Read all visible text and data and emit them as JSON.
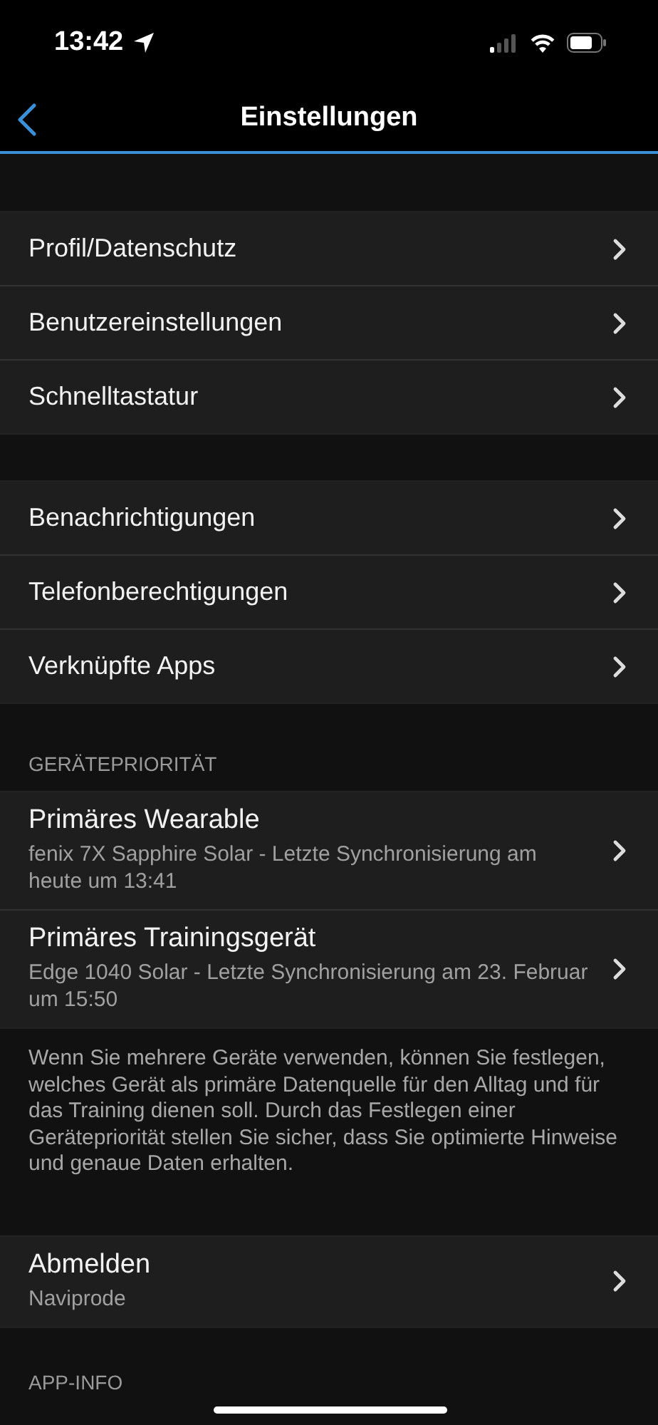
{
  "status_bar": {
    "time": "13:42"
  },
  "nav": {
    "title": "Einstellungen"
  },
  "sections": [
    {
      "items": [
        {
          "title": "Profil/Datenschutz"
        },
        {
          "title": "Benutzereinstellungen"
        },
        {
          "title": "Schnelltastatur"
        }
      ]
    },
    {
      "items": [
        {
          "title": "Benachrichtigungen"
        },
        {
          "title": "Telefonberechtigungen"
        },
        {
          "title": "Verknüpfte Apps"
        }
      ]
    },
    {
      "header": "GERÄTEPRIORITÄT",
      "items": [
        {
          "title": "Primäres Wearable",
          "subtitle": "fenix 7X Sapphire Solar - Letzte Synchronisierung am heute um 13:41"
        },
        {
          "title": "Primäres Trainingsgerät",
          "subtitle": "Edge 1040 Solar - Letzte Synchronisierung am 23. Februar um 15:50"
        }
      ],
      "footer": "Wenn Sie mehrere Geräte verwenden, können Sie festlegen, welches Gerät als primäre Datenquelle für den Alltag und für das Training dienen soll. Durch das Festlegen einer Gerätepriorität stellen Sie sicher, dass Sie optimierte Hinweise und genaue Daten erhalten."
    },
    {
      "items": [
        {
          "title": "Abmelden",
          "subtitle": "Naviprode"
        }
      ]
    },
    {
      "header": "APP-INFO"
    }
  ]
}
